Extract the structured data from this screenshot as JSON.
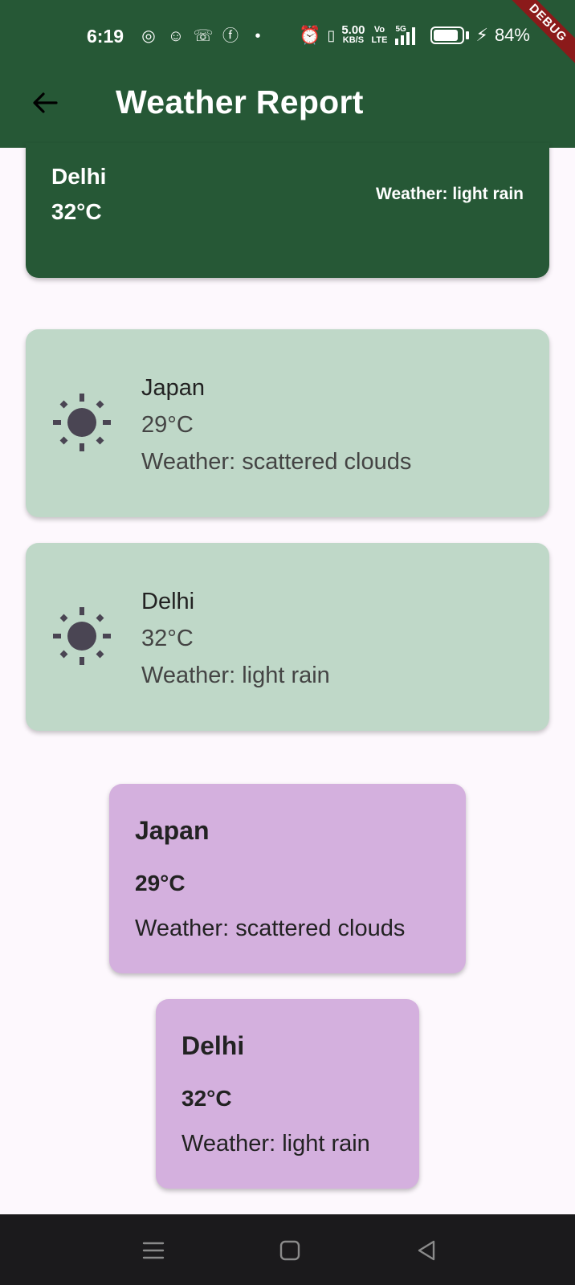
{
  "status_bar": {
    "time": "6:19",
    "net_speed": "5.00",
    "net_unit": "KB/S",
    "volte_top": "Vo",
    "volte_bottom": "LTE",
    "signal": "5G",
    "battery": "84%"
  },
  "debug_banner": "DEBUG",
  "app_bar": {
    "title": "Weather Report"
  },
  "featured": {
    "city": "Delhi",
    "temp": "32°C",
    "weather": "Weather: light rain"
  },
  "list_cards": [
    {
      "city": "Japan",
      "temp": "29°C",
      "weather": "Weather: scattered clouds",
      "icon": "sun-icon"
    },
    {
      "city": "Delhi",
      "temp": "32°C",
      "weather": "Weather: light rain",
      "icon": "sun-icon"
    }
  ],
  "purple_cards": [
    {
      "city": "Japan",
      "temp": "29°C",
      "weather": "Weather: scattered clouds"
    },
    {
      "city": "Delhi",
      "temp": "32°C",
      "weather": "Weather: light rain"
    }
  ],
  "colors": {
    "app_bar": "#265836",
    "list_card": "#bfd8c8",
    "purple_card": "#d4b0de",
    "background": "#fdf8fd",
    "nav_bar": "#1b1a1c"
  }
}
